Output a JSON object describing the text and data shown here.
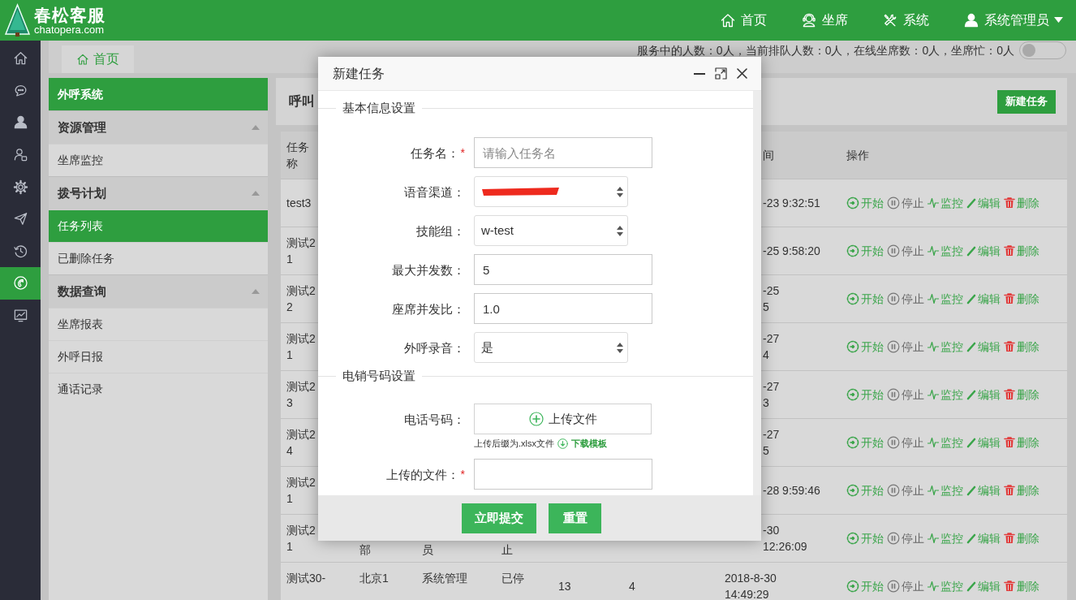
{
  "header": {
    "logo": {
      "title": "春松客服",
      "subtitle": "chatopera.com"
    },
    "nav": [
      {
        "kind": "home",
        "label": "首页"
      },
      {
        "kind": "headset",
        "label": "坐席"
      },
      {
        "kind": "tools",
        "label": "系统"
      },
      {
        "kind": "user",
        "label": "系统管理员",
        "dropdown": true
      }
    ]
  },
  "rail": [
    {
      "kind": "home",
      "selected": false
    },
    {
      "kind": "chat",
      "selected": false
    },
    {
      "kind": "user",
      "selected": false
    },
    {
      "kind": "contact",
      "selected": false
    },
    {
      "kind": "gear",
      "selected": false
    },
    {
      "kind": "send",
      "selected": false
    },
    {
      "kind": "history",
      "selected": false
    },
    {
      "kind": "phone",
      "selected": true
    },
    {
      "kind": "chart",
      "selected": false
    }
  ],
  "tabs": [
    {
      "label": "首页",
      "selected": true
    }
  ],
  "status_text": "服务中的人数：0人，当前排队人数：0人，在线坐席数：0人，坐席忙：0人",
  "toggle": {
    "on": false
  },
  "sidebar": {
    "title": "外呼系统",
    "groups": [
      {
        "label": "资源管理",
        "expanded": true,
        "items": [
          {
            "label": "坐席监控",
            "selected": false
          }
        ]
      },
      {
        "label": "拨号计划",
        "expanded": true,
        "items": [
          {
            "label": "任务列表",
            "selected": true
          },
          {
            "label": "已删除任务",
            "selected": false
          }
        ]
      },
      {
        "label": "数据查询",
        "expanded": true,
        "items": [
          {
            "label": "坐席报表",
            "selected": false
          },
          {
            "label": "外呼日报",
            "selected": false
          },
          {
            "label": "通话记录",
            "selected": false
          }
        ]
      }
    ]
  },
  "toolbar": {
    "title": "呼叫",
    "new_button": "新建任务"
  },
  "table": {
    "columns": {
      "column_1": {
        "lines": [
          "任务",
          "称"
        ]
      },
      "column_7": {
        "lines": [
          "间"
        ],
        "left_hidden": true
      },
      "column_8": {
        "lines": [
          "操作"
        ]
      }
    },
    "rows": [
      {
        "column_1": {
          "lines": [
            "test3"
          ]
        },
        "column_7": {
          "lines": [
            "-23 9:32:51"
          ],
          "left_hidden": true
        },
        "actions": [
          {
            "kind": "start",
            "label": "开始"
          },
          {
            "kind": "stop",
            "label": "停止"
          },
          {
            "kind": "monitor",
            "label": "监控"
          },
          {
            "kind": "edit",
            "label": "编辑"
          },
          {
            "kind": "delete",
            "label": "删除"
          }
        ]
      },
      {
        "column_1": {
          "lines": [
            "测试2",
            "1"
          ]
        },
        "column_7": {
          "lines": [
            "-25 9:58:20"
          ],
          "left_hidden": true
        },
        "actions": [
          {
            "kind": "start",
            "label": "开始"
          },
          {
            "kind": "stop",
            "label": "停止"
          },
          {
            "kind": "monitor",
            "label": "监控"
          },
          {
            "kind": "edit",
            "label": "编辑"
          },
          {
            "kind": "delete",
            "label": "删除"
          }
        ]
      },
      {
        "column_1": {
          "lines": [
            "测试2",
            "2"
          ]
        },
        "column_7": {
          "lines": [
            "-25",
            "5"
          ],
          "left_hidden": true
        },
        "actions": [
          {
            "kind": "start",
            "label": "开始"
          },
          {
            "kind": "stop",
            "label": "停止"
          },
          {
            "kind": "monitor",
            "label": "监控"
          },
          {
            "kind": "edit",
            "label": "编辑"
          },
          {
            "kind": "delete",
            "label": "删除"
          }
        ]
      },
      {
        "column_1": {
          "lines": [
            "测试2",
            "1"
          ]
        },
        "column_7": {
          "lines": [
            "-27",
            "4"
          ],
          "left_hidden": true
        },
        "actions": [
          {
            "kind": "start",
            "label": "开始"
          },
          {
            "kind": "stop",
            "label": "停止"
          },
          {
            "kind": "monitor",
            "label": "监控"
          },
          {
            "kind": "edit",
            "label": "编辑"
          },
          {
            "kind": "delete",
            "label": "删除"
          }
        ]
      },
      {
        "column_1": {
          "lines": [
            "测试2",
            "3"
          ]
        },
        "column_7": {
          "lines": [
            "-27",
            "3"
          ],
          "left_hidden": true
        },
        "actions": [
          {
            "kind": "start",
            "label": "开始"
          },
          {
            "kind": "stop",
            "label": "停止"
          },
          {
            "kind": "monitor",
            "label": "监控"
          },
          {
            "kind": "edit",
            "label": "编辑"
          },
          {
            "kind": "delete",
            "label": "删除"
          }
        ]
      },
      {
        "column_1": {
          "lines": [
            "测试2",
            "4"
          ]
        },
        "column_7": {
          "lines": [
            "-27",
            "5"
          ],
          "left_hidden": true
        },
        "actions": [
          {
            "kind": "start",
            "label": "开始"
          },
          {
            "kind": "stop",
            "label": "停止"
          },
          {
            "kind": "monitor",
            "label": "监控"
          },
          {
            "kind": "edit",
            "label": "编辑"
          },
          {
            "kind": "delete",
            "label": "删除"
          }
        ]
      },
      {
        "column_1": {
          "lines": [
            "测试2",
            "1"
          ]
        },
        "column_7": {
          "lines": [
            "-28 9:59:46"
          ],
          "left_hidden": true
        },
        "actions": [
          {
            "kind": "start",
            "label": "开始"
          },
          {
            "kind": "stop",
            "label": "停止"
          },
          {
            "kind": "monitor",
            "label": "监控"
          },
          {
            "kind": "edit",
            "label": "编辑"
          },
          {
            "kind": "delete",
            "label": "删除"
          }
        ]
      },
      {
        "column_1": {
          "lines": [
            "测试2",
            "1"
          ]
        },
        "column_2": {
          "lines": [
            "部"
          ],
          "top_hidden": true
        },
        "column_3": {
          "lines": [
            "员"
          ],
          "top_hidden": true
        },
        "column_4": {
          "lines": [
            "止"
          ],
          "top_hidden": true
        },
        "column_7": {
          "lines": [
            "-30",
            "12:26:09"
          ],
          "left_hidden": true
        },
        "actions": [
          {
            "kind": "start",
            "label": "开始"
          },
          {
            "kind": "stop",
            "label": "停止"
          },
          {
            "kind": "monitor",
            "label": "监控"
          },
          {
            "kind": "edit",
            "label": "编辑"
          },
          {
            "kind": "delete",
            "label": "删除"
          }
        ]
      },
      {
        "column_1": {
          "lines": [
            "测试30-"
          ],
          "bottom_hidden": true
        },
        "column_2": {
          "lines": [
            "北京1"
          ],
          "bottom_hidden": true
        },
        "column_3": {
          "lines": [
            "系统管理"
          ],
          "bottom_hidden": true
        },
        "column_4": {
          "lines": [
            "已停"
          ],
          "bottom_hidden": true
        },
        "column_5": {
          "lines": [
            "13"
          ]
        },
        "column_6": {
          "lines": [
            "4"
          ]
        },
        "column_7": {
          "lines": [
            "2018-8-30",
            "14:49:29"
          ]
        },
        "actions": [
          {
            "kind": "start",
            "label": "开始"
          },
          {
            "kind": "stop",
            "label": "停止"
          },
          {
            "kind": "monitor",
            "label": "监控"
          },
          {
            "kind": "edit",
            "label": "编辑"
          },
          {
            "kind": "delete",
            "label": "删除"
          }
        ]
      }
    ]
  },
  "modal": {
    "title": "新建任务",
    "sections": [
      {
        "legend": "基本信息设置",
        "fields": [
          {
            "kind": "input",
            "label": "任务名：",
            "required_mark": "*",
            "placeholder": "请输入任务名"
          },
          {
            "kind": "select",
            "label": "语音渠道：",
            "redacted": true
          },
          {
            "kind": "select",
            "label": "技能组：",
            "value": "w-test"
          },
          {
            "kind": "input",
            "label": "最大并发数：",
            "value": "5"
          },
          {
            "kind": "input",
            "label": "座席并发比：",
            "value": "1.0"
          },
          {
            "kind": "select",
            "label": "外呼录音：",
            "value": "是"
          }
        ]
      },
      {
        "legend": "电销号码设置",
        "fields": [
          {
            "kind": "upload",
            "label": "电话号码：",
            "button": "上传文件",
            "hint": "上传后缀为.xlsx文件",
            "link": "下载模板"
          },
          {
            "kind": "input",
            "label": "上传的文件：",
            "required_mark": "*"
          }
        ]
      }
    ],
    "buttons": [
      "立即提交",
      "重置"
    ]
  }
}
